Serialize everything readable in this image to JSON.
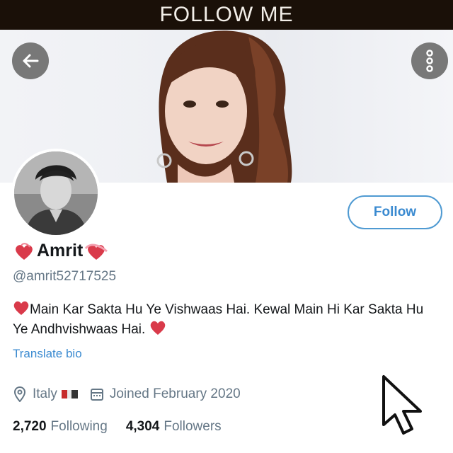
{
  "header": {
    "title": "FOLLOW ME"
  },
  "nav": {
    "back_icon": "arrow-left-icon",
    "more_icon": "more-vertical-icon"
  },
  "profile": {
    "name": "Amrit",
    "handle": "@amrit52717525",
    "follow_label": "Follow",
    "bio": "Main Kar Sakta Hu Ye Vishwaas Hai. Kewal Main Hi Kar Sakta Hu Ye Andhvishwaas Hai.",
    "translate_label": "Translate bio",
    "location": "Italy",
    "joined": "Joined February 2020",
    "following_count": "2,720",
    "following_label": "Following",
    "followers_count": "4,304",
    "followers_label": "Followers"
  },
  "colors": {
    "accent": "#3a8ad0",
    "topbar_bg": "#1a1008",
    "muted": "#657786",
    "heart": "#d93a4a"
  }
}
